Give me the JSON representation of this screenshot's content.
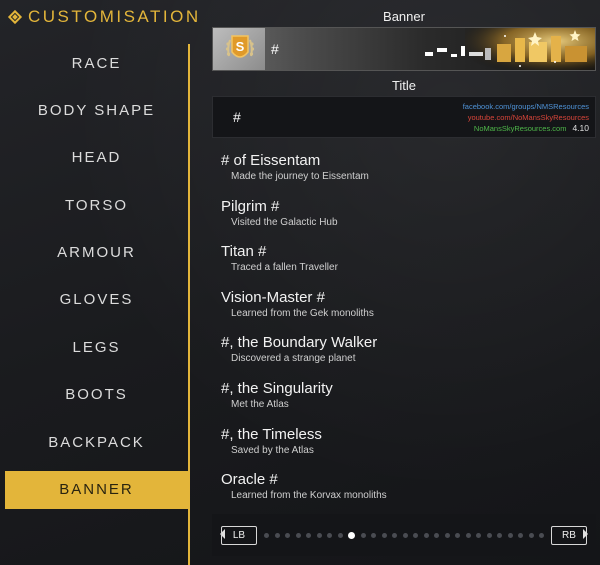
{
  "header": {
    "title": "CUSTOMISATION"
  },
  "nav": {
    "items": [
      {
        "label": "RACE",
        "active": false
      },
      {
        "label": "BODY SHAPE",
        "active": false
      },
      {
        "label": "HEAD",
        "active": false
      },
      {
        "label": "TORSO",
        "active": false
      },
      {
        "label": "ARMOUR",
        "active": false
      },
      {
        "label": "GLOVES",
        "active": false
      },
      {
        "label": "LEGS",
        "active": false
      },
      {
        "label": "BOOTS",
        "active": false
      },
      {
        "label": "BACKPACK",
        "active": false
      },
      {
        "label": "BANNER",
        "active": true
      }
    ]
  },
  "banner": {
    "label": "Banner",
    "hash": "#",
    "badge_letter": "S"
  },
  "title_section": {
    "label": "Title",
    "hash": "#",
    "watermark": {
      "line1": "facebook.com/groups/NMSResources",
      "line2": "youtube.com/NoMansSkyResources",
      "line3": "NoMansSkyResources.com",
      "version": "4.10"
    }
  },
  "titles": [
    {
      "name": "# of Eissentam",
      "desc": "Made the journey to Eissentam"
    },
    {
      "name": "Pilgrim #",
      "desc": "Visited the Galactic Hub"
    },
    {
      "name": "Titan #",
      "desc": "Traced a fallen Traveller"
    },
    {
      "name": "Vision-Master #",
      "desc": "Learned from the Gek monoliths"
    },
    {
      "name": "#, the Boundary Walker",
      "desc": "Discovered a strange planet"
    },
    {
      "name": "#, the Singularity",
      "desc": "Met the Atlas"
    },
    {
      "name": "#, the Timeless",
      "desc": "Saved by the Atlas"
    },
    {
      "name": "Oracle #",
      "desc": "Learned from the Korvax monoliths"
    }
  ],
  "pager": {
    "prev_label": "LB",
    "next_label": "RB",
    "page_count": 27,
    "current_page": 9
  },
  "colors": {
    "accent": "#e3b53a",
    "background": "#1b1c1f"
  }
}
